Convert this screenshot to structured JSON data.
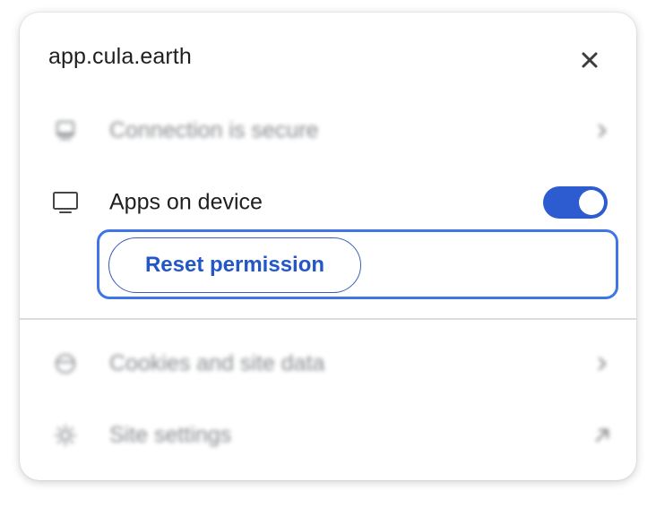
{
  "header": {
    "site": "app.cula.earth",
    "close_icon": "close-icon"
  },
  "rows": {
    "connection": {
      "label": "Connection is secure",
      "icon": "lock-screen-icon",
      "trail_icon": "chevron-right-icon"
    },
    "apps": {
      "label": "Apps on device",
      "icon": "monitor-icon",
      "toggle_on": true
    },
    "reset": {
      "label": "Reset permission"
    },
    "cookies": {
      "label": "Cookies and site data",
      "icon": "cookie-icon",
      "trail_icon": "chevron-right-icon"
    },
    "settings": {
      "label": "Site settings",
      "icon": "gear-icon",
      "trail_icon": "external-link-icon"
    }
  },
  "colors": {
    "accent": "#2d5bd0",
    "focus_ring": "#3f75e6",
    "button_text": "#2357c7"
  }
}
